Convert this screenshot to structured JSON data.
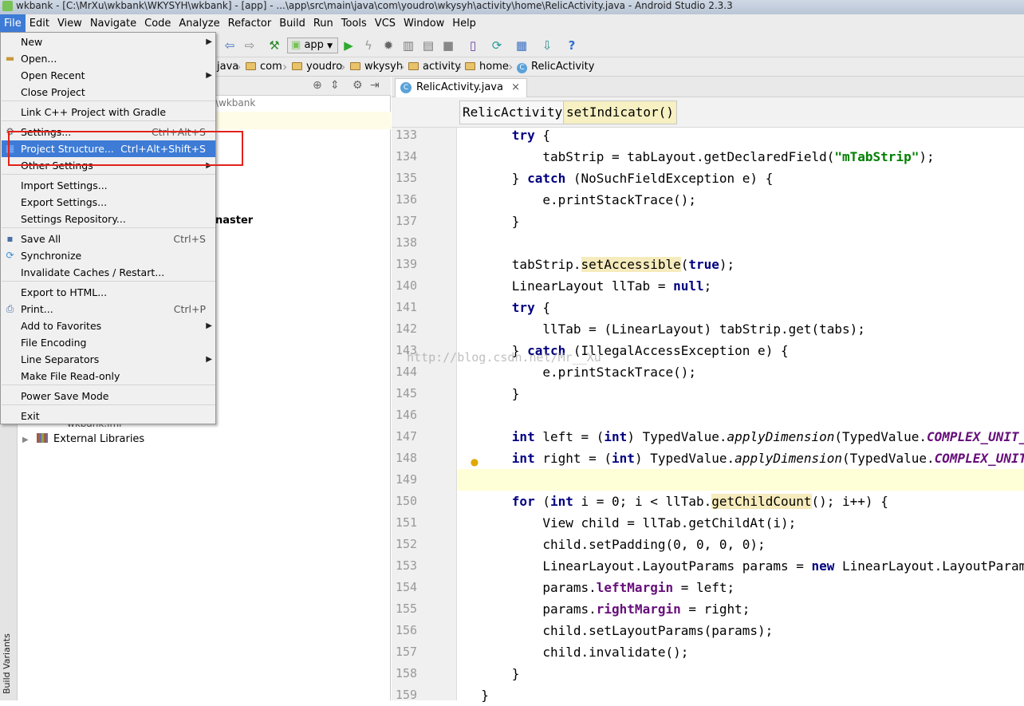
{
  "window": {
    "title": "wkbank - [C:\\MrXu\\wkbank\\WKYSYH\\wkbank] - [app] - ...\\app\\src\\main\\java\\com\\youdro\\wkysyh\\activity\\home\\RelicActivity.java - Android Studio 2.3.3"
  },
  "menubar": [
    "File",
    "Edit",
    "View",
    "Navigate",
    "Code",
    "Analyze",
    "Refactor",
    "Build",
    "Run",
    "Tools",
    "VCS",
    "Window",
    "Help"
  ],
  "toolbar": {
    "run_config": "app",
    "icons": [
      "back-icon",
      "forward-icon",
      "build-hammer-icon",
      "run-icon",
      "apply-changes-icon",
      "debug-icon",
      "profile-icon",
      "attach-debugger-icon",
      "stop-icon",
      "avd-manager-icon",
      "sync-gradle-icon",
      "project-structure-icon",
      "sdk-manager-icon",
      "help-icon"
    ]
  },
  "breadcrumbs": [
    "java",
    "com",
    "youdro",
    "wkysyh",
    "activity",
    "home",
    "RelicActivity"
  ],
  "project": {
    "path_fragment": "\\wkbank",
    "master_label": "naster",
    "external_libraries": "External Libraries",
    "iml_fragment": "wkbank.iml"
  },
  "editor": {
    "tab": "RelicActivity.java",
    "tab_close": "×",
    "method_crumbs": [
      "RelicActivity",
      "setIndicator()"
    ],
    "watermark": "http://blog.csdn.net/Mr__Xu",
    "line_numbers": [
      "133",
      "134",
      "135",
      "136",
      "137",
      "138",
      "139",
      "140",
      "141",
      "142",
      "143",
      "144",
      "145",
      "146",
      "147",
      "148",
      "149",
      "150",
      "151",
      "152",
      "153",
      "154",
      "155",
      "156",
      "157",
      "158",
      "159"
    ]
  },
  "file_menu": {
    "items": [
      {
        "label": "New",
        "submenu": true
      },
      {
        "label": "Open...",
        "icon": "folder-icon"
      },
      {
        "label": "Open Recent",
        "submenu": true
      },
      {
        "label": "Close Project"
      },
      {
        "label": "Link C++ Project with Gradle"
      },
      {
        "label": "Settings...",
        "shortcut": "Ctrl+Alt+S",
        "icon": "settings-icon"
      },
      {
        "label": "Project Structure...",
        "shortcut": "Ctrl+Alt+Shift+S",
        "selected": true,
        "icon": "project-structure-icon"
      },
      {
        "label": "Other Settings",
        "submenu": true
      },
      {
        "label": "Import Settings..."
      },
      {
        "label": "Export Settings..."
      },
      {
        "label": "Settings Repository..."
      },
      {
        "label": "Save All",
        "shortcut": "Ctrl+S",
        "icon": "save-icon"
      },
      {
        "label": "Synchronize",
        "icon": "sync-icon"
      },
      {
        "label": "Invalidate Caches / Restart..."
      },
      {
        "label": "Export to HTML..."
      },
      {
        "label": "Print...",
        "shortcut": "Ctrl+P",
        "icon": "print-icon"
      },
      {
        "label": "Add to Favorites",
        "submenu": true
      },
      {
        "label": "File Encoding"
      },
      {
        "label": "Line Separators",
        "submenu": true
      },
      {
        "label": "Make File Read-only"
      },
      {
        "label": "Power Save Mode"
      },
      {
        "label": "Exit"
      }
    ]
  },
  "side_tool": {
    "build_variants": "Build Variants"
  },
  "colors": {
    "keyword": "#000080",
    "string": "#008000",
    "field": "#660e7a",
    "selection": "#3d7bd6",
    "highlight_box": "#e2231a",
    "current_line": "#ffffd7"
  }
}
